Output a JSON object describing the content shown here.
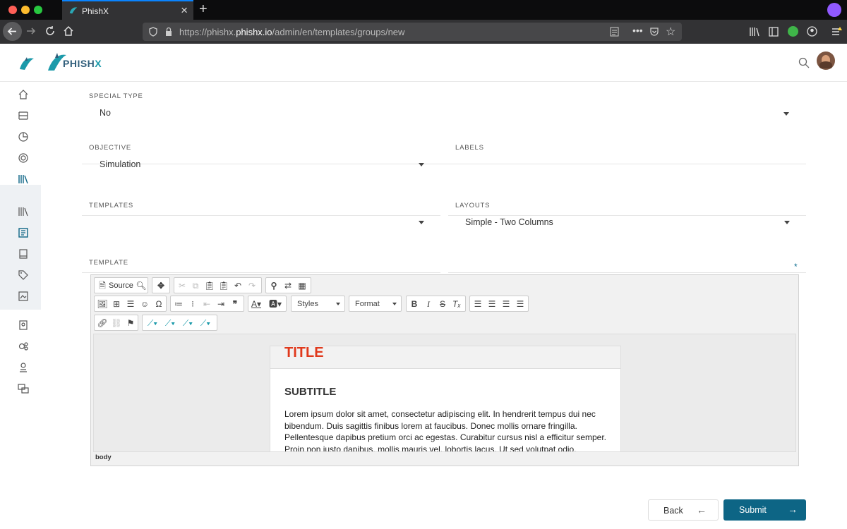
{
  "browser": {
    "tab_title": "PhishX",
    "url_prefix": "https://phishx.",
    "url_domain": "phishx.io",
    "url_path": "/admin/en/templates/groups/new"
  },
  "app": {
    "logo_text_a": "PHISH",
    "logo_text_b": "X"
  },
  "form": {
    "special_type": {
      "label": "SPECIAL TYPE",
      "value": "No"
    },
    "objective": {
      "label": "OBJECTIVE",
      "value": "Simulation"
    },
    "labels": {
      "label": "LABELS",
      "value": ""
    },
    "templates": {
      "label": "TEMPLATES",
      "value": ""
    },
    "layouts": {
      "label": "LAYOUTS",
      "value": "Simple - Two Columns"
    },
    "template": {
      "label": "TEMPLATE",
      "required_mark": "*"
    }
  },
  "editor": {
    "source_label": "Source",
    "styles_label": "Styles",
    "format_label": "Format",
    "doc_title": "TITLE",
    "doc_subtitle": "SUBTITLE",
    "doc_body": "Lorem ipsum dolor sit amet, consectetur adipiscing elit. In hendrerit tempus dui nec bibendum. Duis sagittis finibus lorem at faucibus. Donec mollis ornare fringilla. Pellentesque dapibus pretium orci ac egestas. Curabitur cursus nisl a efficitur semper. Proin non justo dapibus, mollis mauris vel, lobortis lacus. Ut sed volutpat odio. Phasellus",
    "path": "body",
    "colors": {
      "title": "#e0391c"
    }
  },
  "actions": {
    "back_label": "Back",
    "submit_label": "Submit"
  },
  "colors": {
    "primary": "#0d6585",
    "accent": "#1b9aaa"
  }
}
